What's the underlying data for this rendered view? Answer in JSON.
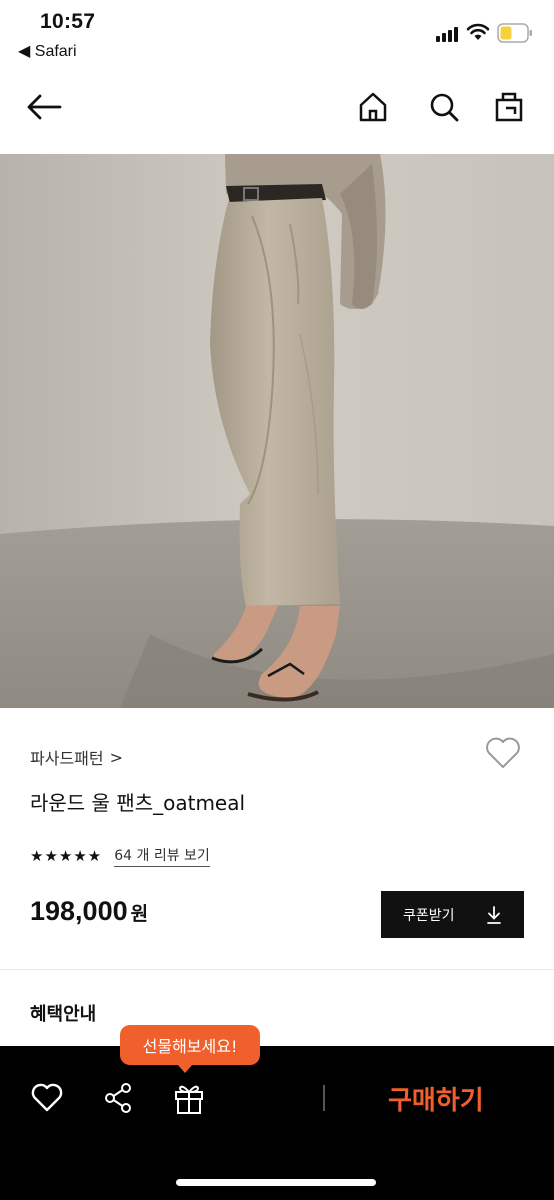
{
  "status_bar": {
    "time": "10:57",
    "back_app": "Safari",
    "battery_color": "#f5d23c"
  },
  "nav": {
    "icons": [
      "back-arrow-icon",
      "home-icon",
      "search-icon",
      "shopping-bag-icon"
    ]
  },
  "hero": {
    "image": "model wearing oatmeal wool pants"
  },
  "product": {
    "brand": "파사드패턴",
    "brand_chevron": ">",
    "name": "라운드 울 팬츠_oatmeal",
    "stars": "★★★★★",
    "rating": 5,
    "reviews": "64 개 리뷰 보기",
    "price": "198,000",
    "price_unit": "원",
    "coupon_label": "쿠폰받기"
  },
  "benefits": {
    "title": "혜택안내"
  },
  "bottom_bar": {
    "gift_tooltip": "선물해보세요!",
    "buy_label": "구매하기",
    "accent_color": "#f0602c"
  }
}
